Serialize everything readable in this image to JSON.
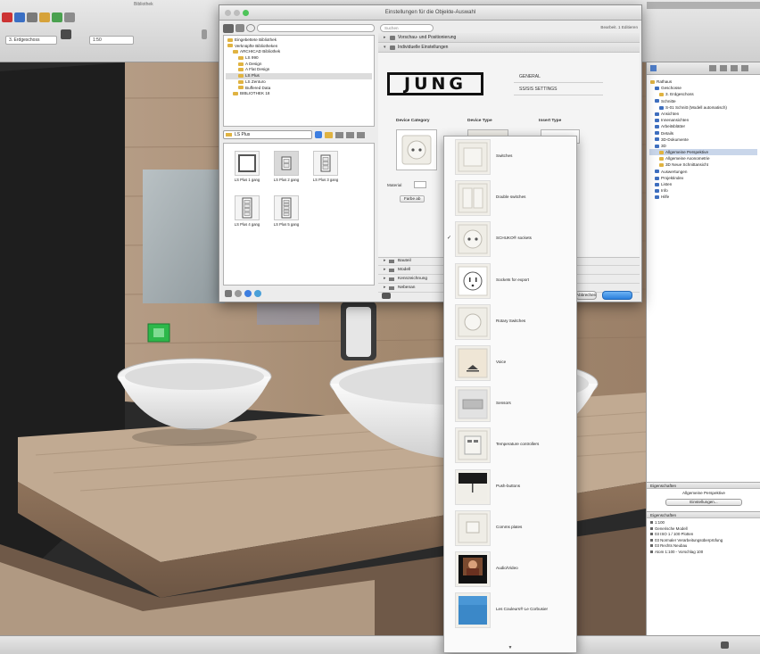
{
  "toolbar": {
    "layer_dropdown": "3. Erdgeschoss",
    "scale_field": "1:50",
    "tab_label": "Bibliothek"
  },
  "dialog": {
    "title": "Einstellungen für die Objekte-Auswahl",
    "search_placeholder": "Suchen",
    "selected_info": "Bearbeit. 1 Editieren",
    "library": {
      "tree": [
        {
          "label": "Eingebettete Bibliothek",
          "indent": 0
        },
        {
          "label": "Verknüpfte Bibliotheken",
          "indent": 0
        },
        {
          "label": "ARCHICAD Bibliothek",
          "indent": 1
        },
        {
          "label": "LS 990",
          "indent": 2
        },
        {
          "label": "A Design",
          "indent": 2
        },
        {
          "label": "A Flat Design",
          "indent": 2
        },
        {
          "label": "LS Plus",
          "indent": 2,
          "selected": true
        },
        {
          "label": "LS Zenturo",
          "indent": 2
        },
        {
          "label": "Buffered Data",
          "indent": 2
        },
        {
          "label": "BIBLIOTHEK 18",
          "indent": 1
        }
      ],
      "folder_select": "LS Plus",
      "items": [
        {
          "label": "LS Plus 1 gang",
          "rockers": 1
        },
        {
          "label": "LS Plus 2 gang",
          "rockers": 2,
          "selected": true
        },
        {
          "label": "LS Plus 3 gang",
          "rockers": 3
        },
        {
          "label": "LS Plus 4 gang",
          "rockers": 4
        },
        {
          "label": "LS Plus 5 gang",
          "rockers": 5
        }
      ]
    },
    "settings": {
      "sections": [
        {
          "label": "Vorschau- und Positionierung"
        },
        {
          "label": "Individuelle Einstellungen"
        }
      ],
      "brand": "JUNG",
      "brand_lines": [
        "GENERAL",
        "SS/SIS SETTINGS"
      ],
      "col_device_category": "Device Category",
      "col_device_type": "Device Type",
      "col_insert_type": "Insert Type",
      "small_label": "Material",
      "small_button": "Farbe ab",
      "bottom_rows": [
        "Bauteil",
        "Modell",
        "Kennzeichnung",
        "Nebenan"
      ],
      "cancel_label": "Abbrechen"
    }
  },
  "device_menu": {
    "items": [
      {
        "label": "Switches",
        "thumb": "switch-plate"
      },
      {
        "label": "Double switches",
        "thumb": "double-switch"
      },
      {
        "label": "SCHUKO® sockets",
        "thumb": "socket",
        "checked": true
      },
      {
        "label": "Sockets for export",
        "thumb": "export-socket"
      },
      {
        "label": "Rotary Switches",
        "thumb": "rotary"
      },
      {
        "label": "Voice",
        "thumb": "voice"
      },
      {
        "label": "Sensors",
        "thumb": "sensor"
      },
      {
        "label": "Temperature controllers",
        "thumb": "thermostat"
      },
      {
        "label": "Push-buttons",
        "thumb": "push-button"
      },
      {
        "label": "Comms plates",
        "thumb": "comms"
      },
      {
        "label": "Audio/Video",
        "thumb": "audio-video"
      },
      {
        "label": "Les Couleurs® Le Corbusier",
        "thumb": "corbusier"
      }
    ],
    "more_indicator": "▼"
  },
  "navigator": {
    "tree": [
      {
        "label": "Rathaus",
        "indent": 0,
        "kind": "folder"
      },
      {
        "label": "Geschosse",
        "indent": 1,
        "kind": "view"
      },
      {
        "label": "3. Erdgeschoss",
        "indent": 2,
        "kind": "folder"
      },
      {
        "label": "Schnitte",
        "indent": 1,
        "kind": "view"
      },
      {
        "label": "S-01 Schnitt (Modell automatisch)",
        "indent": 2,
        "kind": "view"
      },
      {
        "label": "Ansichten",
        "indent": 1,
        "kind": "view"
      },
      {
        "label": "Innenansichten",
        "indent": 1,
        "kind": "view"
      },
      {
        "label": "Arbeitsblätter",
        "indent": 1,
        "kind": "view"
      },
      {
        "label": "Details",
        "indent": 1,
        "kind": "view"
      },
      {
        "label": "3D-Dokumente",
        "indent": 1,
        "kind": "view"
      },
      {
        "label": "3D",
        "indent": 1,
        "kind": "view"
      },
      {
        "label": "Allgemeine Perspektive",
        "indent": 2,
        "kind": "folder",
        "selected": true
      },
      {
        "label": "Allgemeine Axonometrie",
        "indent": 2,
        "kind": "folder"
      },
      {
        "label": "3D Neue Schnittansicht",
        "indent": 2,
        "kind": "folder"
      },
      {
        "label": "Auswertungen",
        "indent": 1,
        "kind": "view"
      },
      {
        "label": "Projektindex",
        "indent": 1,
        "kind": "view"
      },
      {
        "label": "Listen",
        "indent": 1,
        "kind": "view"
      },
      {
        "label": "Info",
        "indent": 1,
        "kind": "view"
      },
      {
        "label": "Hilfe",
        "indent": 1,
        "kind": "view"
      }
    ],
    "sep_label": "Eigenschaften",
    "view_name": "Allgemeine Perspektive",
    "settings_button": "Einstellungen...",
    "props_header": "Eigenschaften",
    "props": [
      "1:100",
      "Generische Modell",
      "03 ISO 1 / 100 Plotten",
      "03 Normaler Verarbeitungsüberprüfung",
      "03 Rechts Neubau",
      "Atom 1:100 - Vorschlag 100"
    ]
  },
  "status": {
    "text": ""
  }
}
